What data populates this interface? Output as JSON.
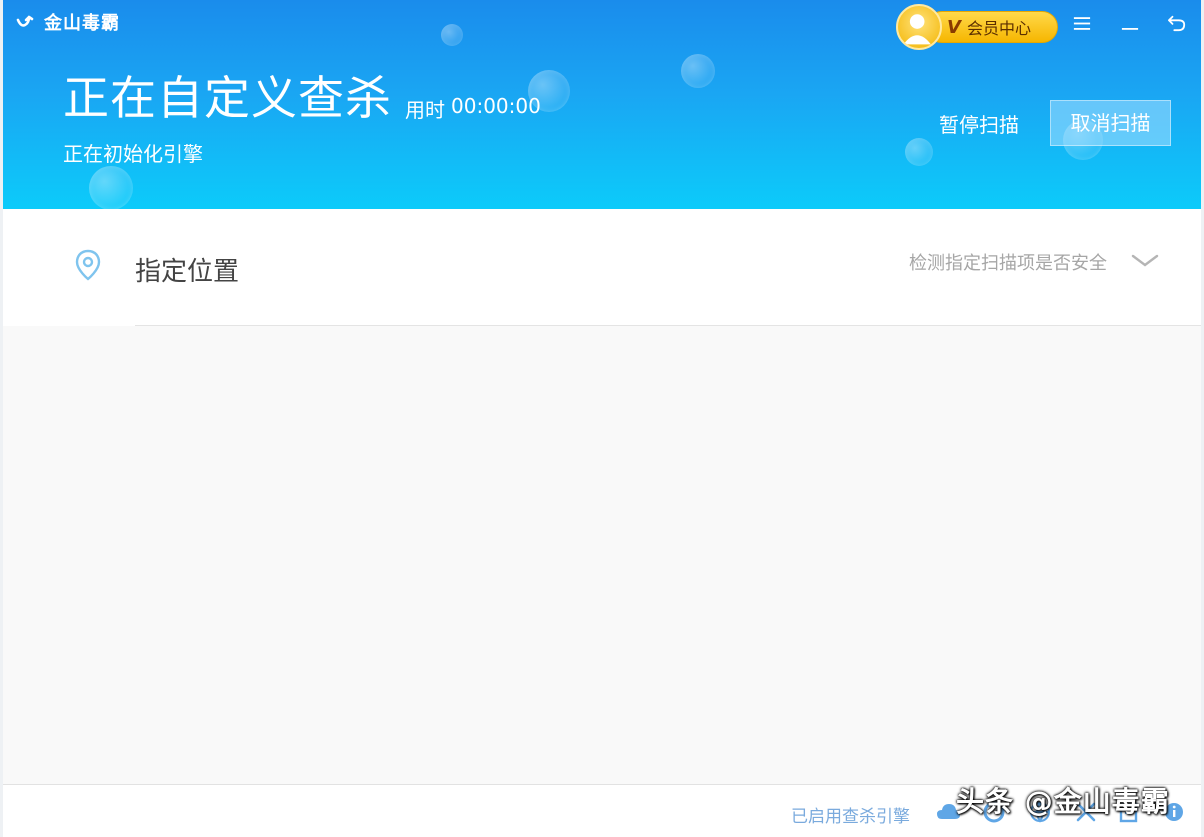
{
  "app": {
    "name": "金山毒霸",
    "vip_badge": "V",
    "vip_label": "会员中心",
    "brand_colors": {
      "header_top": "#1a8cec",
      "header_bottom": "#0ccbfa",
      "vip_gold": "#f6b600"
    }
  },
  "window_controls": {
    "menu_icon": "menu-icon",
    "minimize_icon": "minimize-icon",
    "back_icon": "back-icon"
  },
  "scan": {
    "title": "正在自定义查杀",
    "elapsed_label": "用时",
    "elapsed_value": "00:00:00",
    "status": "正在初始化引擎",
    "pause_label": "暂停扫描",
    "cancel_label": "取消扫描"
  },
  "location": {
    "icon": "location-pin-icon",
    "label": "指定位置",
    "hint": "检测指定扫描项是否安全"
  },
  "footer": {
    "engines_label": "已启用查杀引擎",
    "engine_icons": [
      "cloud-engine-icon",
      "shield-engine-icon",
      "globe-engine-icon",
      "sword-engine-icon",
      "edit-engine-icon",
      "info-engine-icon"
    ]
  },
  "watermark": "头条 @金山毒霸"
}
